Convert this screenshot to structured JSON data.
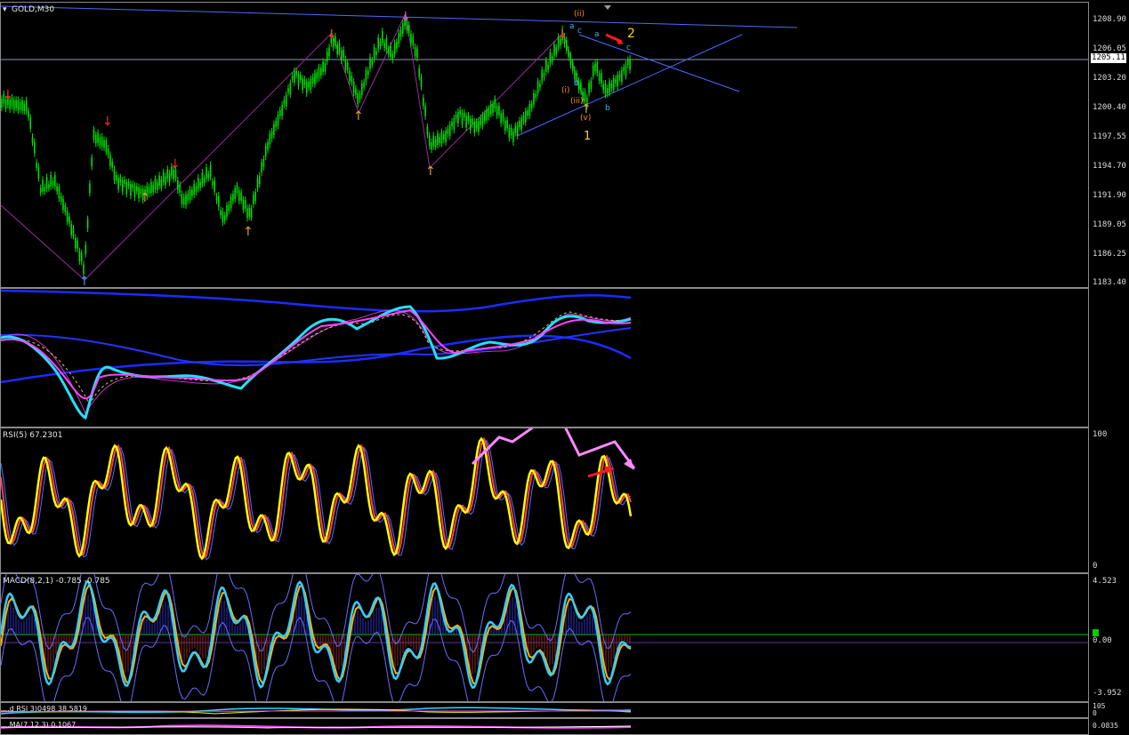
{
  "symbol": "GOLD,M30",
  "colors": {
    "bull": "#00e000",
    "axis": "#8a8a8a",
    "rsi": "#ffff00",
    "macd": "#33ccff"
  },
  "price_scale": {
    "ticks": [
      "1208.90",
      "1206.05",
      "1203.20",
      "1200.40",
      "1197.55",
      "1194.70",
      "1191.90",
      "1189.05",
      "1186.25",
      "1183.40"
    ],
    "current": "1205.11"
  },
  "wave_labels": {
    "ii": "(ii)",
    "two": "2",
    "a1": "a",
    "c1": "c",
    "a2": "a",
    "c2": "c",
    "i": "(i)",
    "b1": "b",
    "iii": "(iii)",
    "v": "(v)",
    "b2": "b",
    "one": "1"
  },
  "rsi": {
    "label": "RSI(5) 67.2301",
    "max": "100",
    "min": "0"
  },
  "macd": {
    "label": "MACD(8,2,1) -0.785 -0.785",
    "max": "4.523",
    "zero": "0.00",
    "min": "-3.952"
  },
  "pane5": {
    "label": "...d RSI 3)0498 38.5819",
    "max": "105",
    "min": "0"
  },
  "pane6": {
    "label": "...MA(7,12,3) 0.1067",
    "value": "0.0835"
  }
}
